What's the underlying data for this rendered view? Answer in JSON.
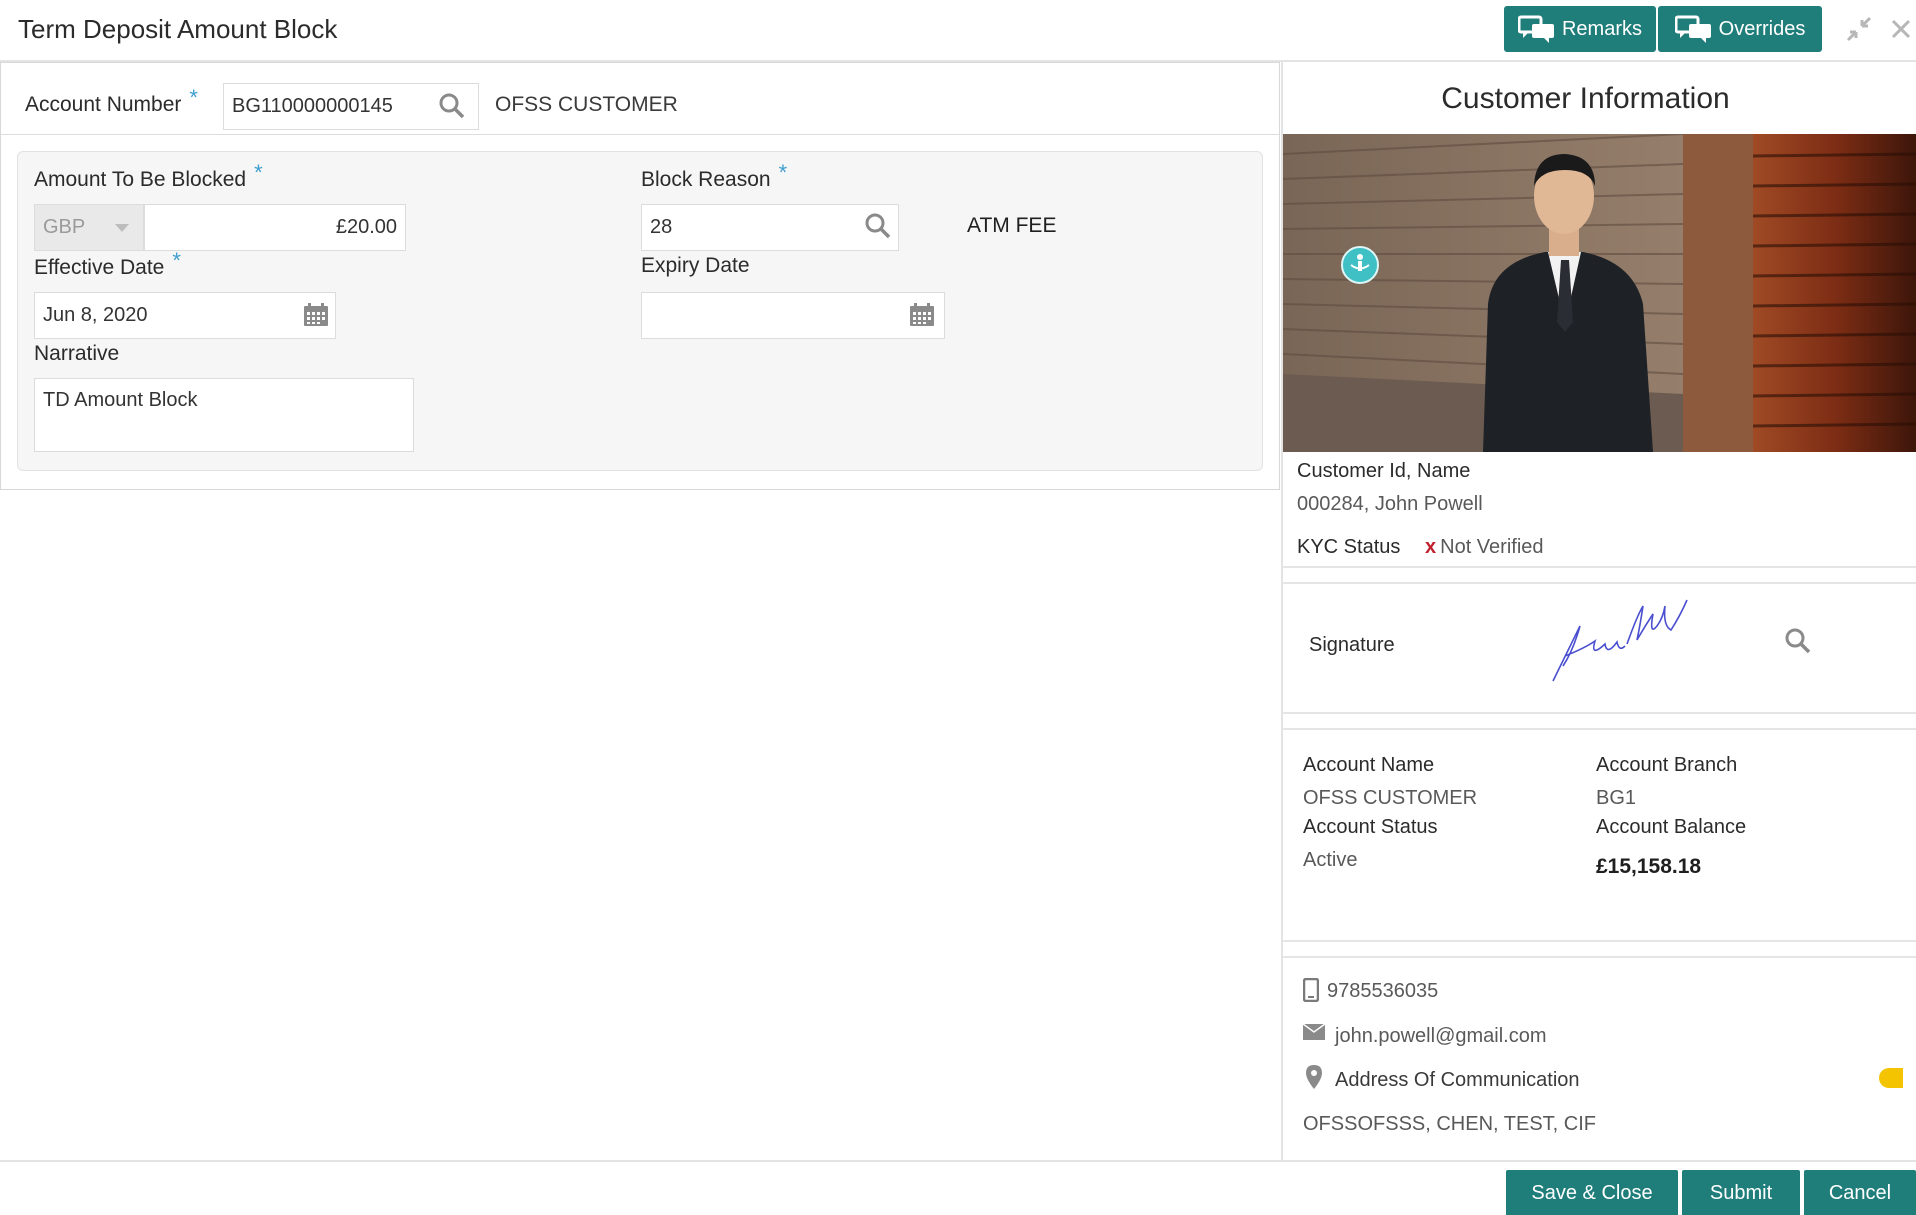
{
  "header": {
    "title": "Term Deposit Amount Block",
    "remarks_label": "Remarks",
    "overrides_label": "Overrides"
  },
  "account": {
    "label": "Account Number",
    "value": "BG110000000145",
    "customer_name": "OFSS CUSTOMER"
  },
  "form": {
    "amount_label": "Amount To Be Blocked",
    "currency": "GBP",
    "amount": "£20.00",
    "block_reason_label": "Block Reason",
    "block_reason_value": "28",
    "block_reason_desc": "ATM FEE",
    "effective_date_label": "Effective Date",
    "effective_date_value": "Jun 8, 2020",
    "expiry_date_label": "Expiry Date",
    "expiry_date_value": "",
    "narrative_label": "Narrative",
    "narrative_value": "TD Amount Block",
    "required_mark": "*"
  },
  "customer_info": {
    "title": "Customer Information",
    "id_name_label": "Customer Id, Name",
    "id_name_value": "000284, John Powell",
    "kyc_label": "KYC Status",
    "kyc_value": "Not Verified",
    "kyc_icon": "x",
    "signature_label": "Signature",
    "account_name_label": "Account Name",
    "account_name_value": "OFSS CUSTOMER",
    "account_branch_label": "Account Branch",
    "account_branch_value": "BG1",
    "account_status_label": "Account Status",
    "account_status_value": "Active",
    "account_balance_label": "Account Balance",
    "account_balance_value": "£15,158.18",
    "phone": "9785536035",
    "email": "john.powell@gmail.com",
    "address_label": "Address Of Communication",
    "address_value": "OFSSOFSSS, CHEN, TEST, CIF"
  },
  "footer": {
    "save_close_label": "Save & Close",
    "submit_label": "Submit",
    "cancel_label": "Cancel"
  },
  "colors": {
    "accent": "#1f7d7a",
    "required": "#3f9fd1",
    "kyc_x": "#c0212e",
    "toggle": "#f5c400"
  }
}
